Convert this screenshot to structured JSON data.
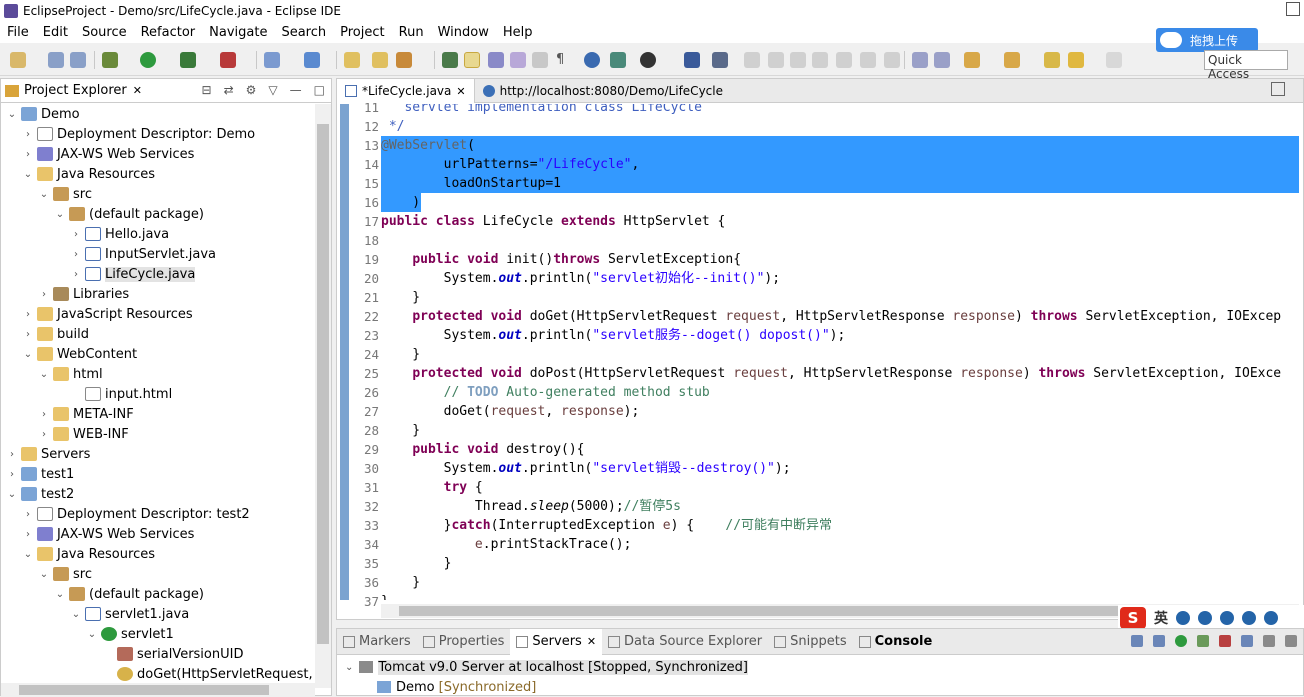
{
  "window": {
    "title": "EclipseProject - Demo/src/LifeCycle.java - Eclipse IDE"
  },
  "menu": [
    "File",
    "Edit",
    "Source",
    "Refactor",
    "Navigate",
    "Search",
    "Project",
    "Run",
    "Window",
    "Help"
  ],
  "quick_access": {
    "placeholder": "Quick Access"
  },
  "baidu": {
    "label": "拖拽上传"
  },
  "project_explorer": {
    "title": "Project Explorer",
    "items": [
      {
        "label": "Demo",
        "icon": "project-icon"
      },
      {
        "label": "Deployment Descriptor: Demo",
        "icon": "deployment-descriptor-icon"
      },
      {
        "label": "JAX-WS Web Services",
        "icon": "web-services-icon"
      },
      {
        "label": "Java Resources",
        "icon": "java-resources-icon"
      },
      {
        "label": "src",
        "icon": "source-folder-icon"
      },
      {
        "label": "(default package)",
        "icon": "package-icon"
      },
      {
        "label": "Hello.java",
        "icon": "java-file-icon"
      },
      {
        "label": "InputServlet.java",
        "icon": "java-file-icon"
      },
      {
        "label": "LifeCycle.java",
        "icon": "java-file-icon"
      },
      {
        "label": "Libraries",
        "icon": "libraries-icon"
      },
      {
        "label": "JavaScript Resources",
        "icon": "javascript-resources-icon"
      },
      {
        "label": "build",
        "icon": "folder-icon"
      },
      {
        "label": "WebContent",
        "icon": "folder-icon"
      },
      {
        "label": "html",
        "icon": "folder-icon"
      },
      {
        "label": "input.html",
        "icon": "html-file-icon"
      },
      {
        "label": "META-INF",
        "icon": "folder-icon"
      },
      {
        "label": "WEB-INF",
        "icon": "folder-icon"
      },
      {
        "label": "Servers",
        "icon": "folder-icon"
      },
      {
        "label": "test1",
        "icon": "project-icon"
      },
      {
        "label": "test2",
        "icon": "project-icon"
      },
      {
        "label": "Deployment Descriptor: test2",
        "icon": "deployment-descriptor-icon"
      },
      {
        "label": "JAX-WS Web Services",
        "icon": "web-services-icon"
      },
      {
        "label": "Java Resources",
        "icon": "java-resources-icon"
      },
      {
        "label": "src",
        "icon": "source-folder-icon"
      },
      {
        "label": "(default package)",
        "icon": "package-icon"
      },
      {
        "label": "servlet1.java",
        "icon": "java-file-icon"
      },
      {
        "label": "servlet1",
        "icon": "class-icon"
      },
      {
        "label": "serialVersionUID",
        "icon": "field-icon"
      },
      {
        "label": "doGet(HttpServletRequest, Htt",
        "icon": "method-icon"
      }
    ]
  },
  "editor": {
    "tabs": [
      {
        "label": "*LifeCycle.java"
      },
      {
        "label": "http://localhost:8080/Demo/LifeCycle"
      }
    ],
    "line_numbers": [
      "11",
      "12",
      "13",
      "14",
      "15",
      "16",
      "17",
      "18",
      "19",
      "20",
      "21",
      "22",
      "23",
      "24",
      "25",
      "26",
      "27",
      "28",
      "29",
      "30",
      "31",
      "32",
      "33",
      "34",
      "35",
      "36",
      "37"
    ]
  },
  "bottom": {
    "tabs": [
      "Markers",
      "Properties",
      "Servers",
      "Data Source Explorer",
      "Snippets",
      "Console"
    ],
    "server_row": "Tomcat v9.0 Server at localhost  [Stopped, Synchronized]",
    "module_row": "Demo",
    "module_status": "[Synchronized]"
  },
  "ime": {
    "mode": "英"
  }
}
